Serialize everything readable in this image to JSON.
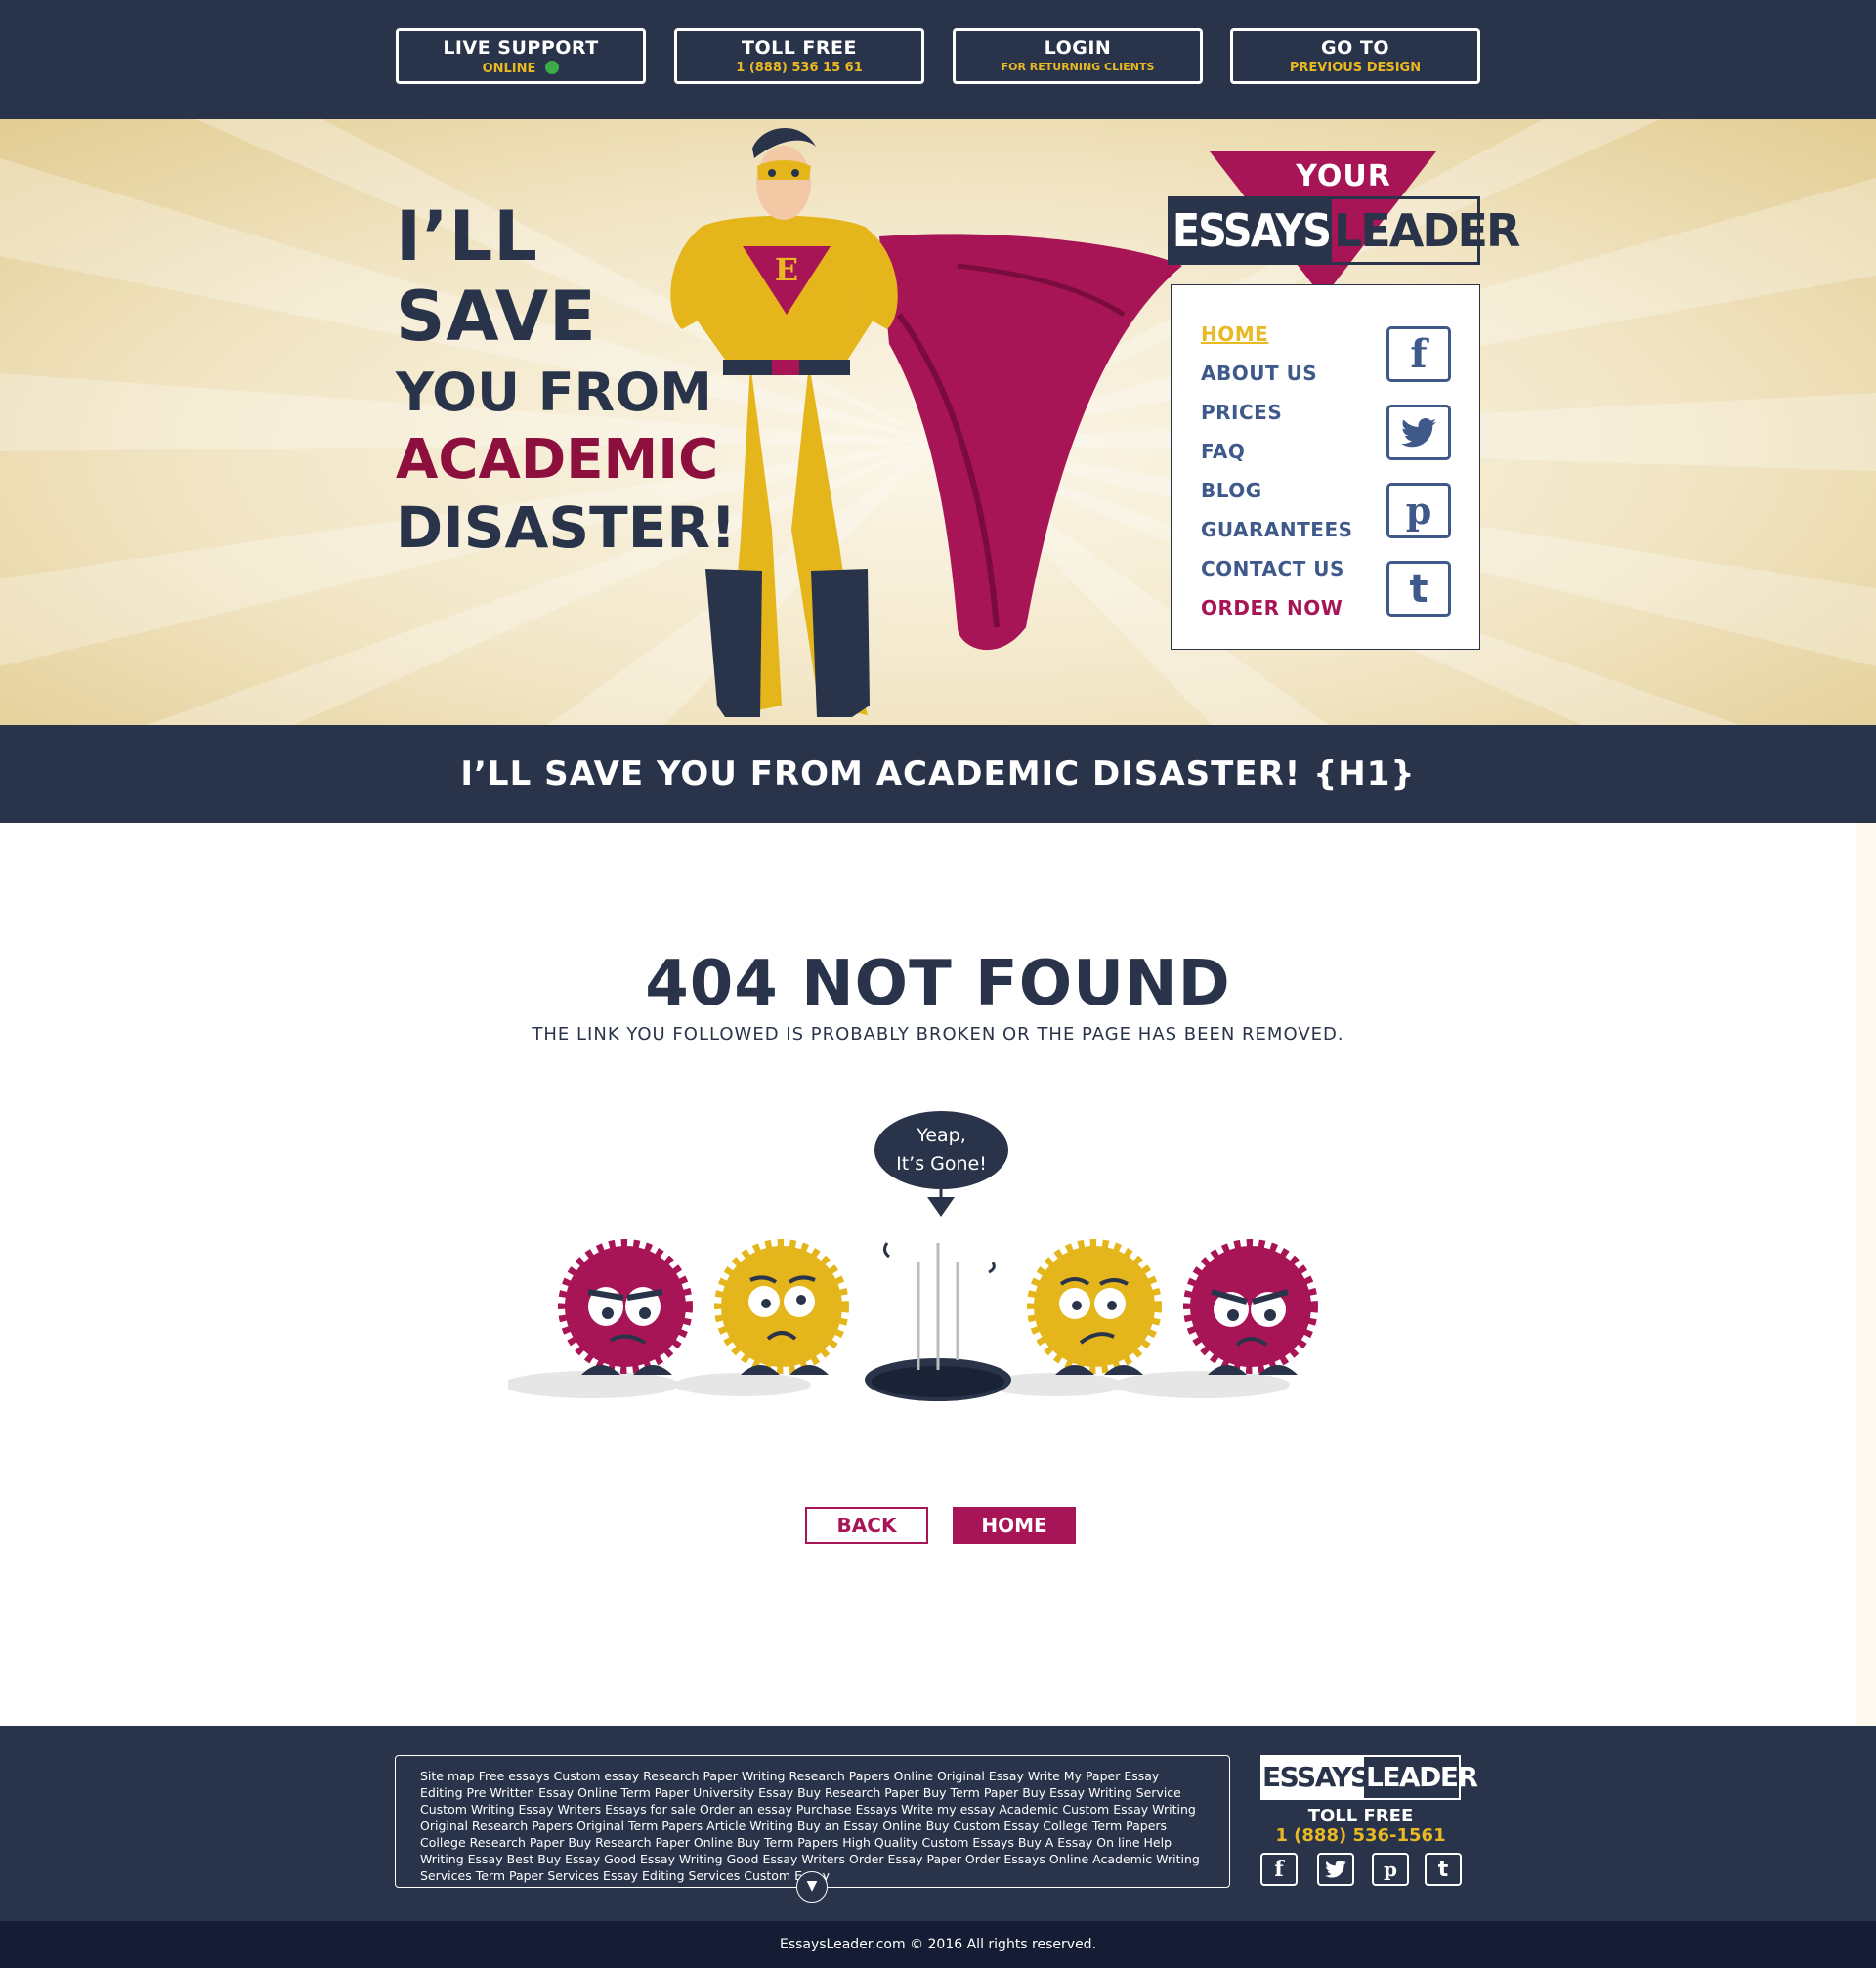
{
  "topbar": {
    "live_support": {
      "title": "LIVE SUPPORT",
      "sub": "ONLINE"
    },
    "toll_free": {
      "title": "TOLL FREE",
      "sub": "1 (888) 536 15 61"
    },
    "login": {
      "title": "LOGIN",
      "sub": "FOR RETURNING CLIENTS"
    },
    "previous": {
      "title": "GO TO",
      "sub": "PREVIOUS DESIGN"
    }
  },
  "hero": {
    "slogan": [
      "I’LL",
      "SAVE",
      "YOU FROM",
      "ACADEMIC",
      "DISASTER!"
    ],
    "logo": {
      "your": "YOUR",
      "essays": "ESSAYS",
      "leader": "LEADER"
    },
    "chest_letter": "E",
    "nav": [
      "HOME",
      "ABOUT US",
      "PRICES",
      "FAQ",
      "BLOG",
      "GUARANTEES",
      "CONTACT US",
      "ORDER NOW"
    ],
    "social": [
      "f",
      "twitter",
      "p",
      "t"
    ]
  },
  "h1": "I’LL SAVE YOU FROM ACADEMIC DISASTER! {H1}",
  "main": {
    "title": "404 NOT FOUND",
    "subtitle": "THE LINK YOU FOLLOWED IS PROBABLY BROKEN OR THE PAGE HAS BEEN REMOVED.",
    "bubble_line1": "Yeap,",
    "bubble_line2": "It’s Gone!",
    "back_label": "BACK",
    "home_label": "HOME"
  },
  "footer": {
    "links": [
      "Site map",
      "Free essays",
      "Custom essay",
      "Research Paper Writing",
      "Research Papers Online",
      "Original Essay",
      "Write My Paper",
      "Essay Editing",
      "Pre Written Essay",
      "Online Term Paper",
      "University Essay",
      "Buy Research Paper",
      "Buy Term Paper",
      "Buy Essay",
      "Writing Service",
      "Custom Writing",
      "Essay Writers",
      "Essays for sale",
      "Order an essay",
      "Purchase Essays",
      "Write my essay",
      "Academic Custom Essay Writing",
      "Original Research Papers",
      "Original Term Papers",
      "Article Writing",
      "Buy an Essay Online",
      "Buy Custom Essay",
      "College Term Papers",
      "College Research Paper",
      "Buy Research Paper Online",
      "Buy Term Papers",
      "High Quality Custom Essays",
      "Buy A Essay On line",
      "Help Writing Essay",
      "Best Buy Essay",
      "Good Essay Writing",
      "Good Essay Writers",
      "Order Essay Paper",
      "Order Essays Online",
      "Academic Writing Services",
      "Term Paper Services",
      "Essay Editing Services",
      "Custom Essay"
    ],
    "logo_essays": "ESSAYS",
    "logo_leader": "LEADER",
    "toll_free": "TOLL FREE",
    "phone": "1 (888) 536-1561",
    "copyright": "EssaysLeader.com © 2016 All rights reserved."
  },
  "colors": {
    "navy": "#293349",
    "gold": "#e8b923",
    "crimson": "#a81556",
    "nav_blue": "#3f5a8a"
  }
}
